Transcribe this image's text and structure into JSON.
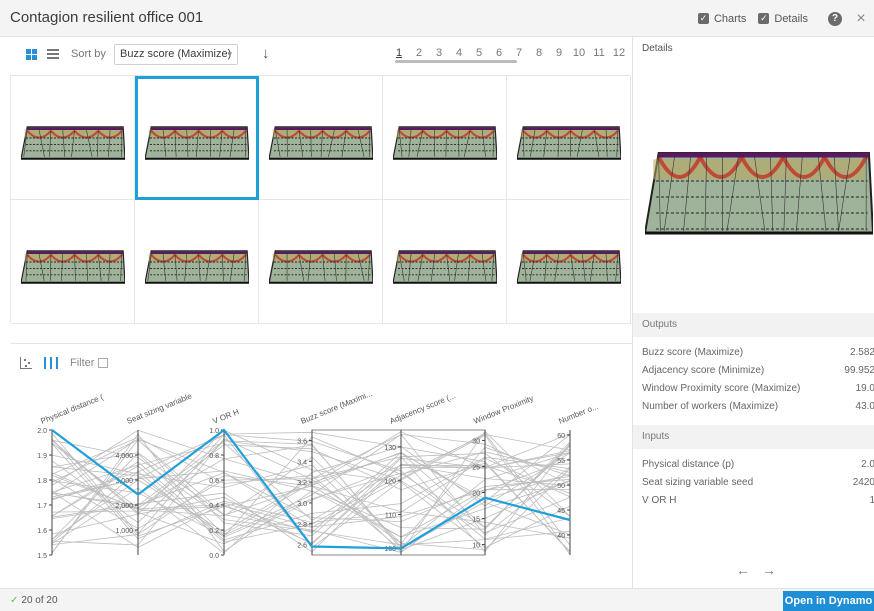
{
  "window": {
    "title": "Contagion resilient office 001",
    "charts_label": "Charts",
    "details_label": "Details",
    "help_symbol": "?",
    "close_symbol": "×"
  },
  "toolbar": {
    "sort_label": "Sort by",
    "sort_value": "Buzz score (Maximize)",
    "sort_direction_icon": "arrow-down-icon",
    "pages": [
      "1",
      "2",
      "3",
      "4",
      "5",
      "6",
      "7",
      "8",
      "9",
      "10",
      "11",
      "12"
    ],
    "active_page": "1"
  },
  "chart_toolbar": {
    "filter_label": "Filter"
  },
  "chart_data": {
    "type": "parallel-coordinates",
    "axes": [
      {
        "name": "Physical distance (",
        "ticks": [
          "2.0",
          "1.9",
          "1.8",
          "1.7",
          "1.6",
          "1.5"
        ],
        "range": [
          1.5,
          2.0
        ]
      },
      {
        "name": "Seat sizing variable",
        "ticks": [
          "4,000",
          "3,000",
          "2,000",
          "1,000"
        ],
        "range": [
          0,
          5000
        ]
      },
      {
        "name": "V OR H",
        "ticks": [
          "1.0",
          "0.8",
          "0.6",
          "0.4",
          "0.2",
          "0.0"
        ],
        "range": [
          0,
          1
        ]
      },
      {
        "name": "Buzz score (Maximi...",
        "ticks": [
          "3.6",
          "3.4",
          "3.2",
          "3.0",
          "2.8",
          "2.6"
        ],
        "range": [
          2.5,
          3.7
        ]
      },
      {
        "name": "Adjacency score (...",
        "ticks": [
          "130",
          "120",
          "110",
          "100"
        ],
        "range": [
          98,
          135
        ]
      },
      {
        "name": "Window Proximity",
        "ticks": [
          "30",
          "25",
          "20",
          "15",
          "10"
        ],
        "range": [
          8,
          32
        ]
      },
      {
        "name": "Number o...",
        "ticks": [
          "60",
          "55",
          "50",
          "45",
          "40"
        ],
        "range": [
          36,
          61
        ]
      }
    ],
    "highlight": [
      2.0,
      2420,
      1,
      2.582,
      99.952,
      19.0,
      43.0
    ]
  },
  "details": {
    "header": "Details",
    "outputs_header": "Outputs",
    "inputs_header": "Inputs",
    "outputs": [
      {
        "label": "Buzz score (Maximize)",
        "value": "2.582"
      },
      {
        "label": "Adjacency score (Minimize)",
        "value": "99.952"
      },
      {
        "label": "Window Proximity score (Maximize)",
        "value": "19.0"
      },
      {
        "label": "Number of workers (Maximize)",
        "value": "43.0"
      }
    ],
    "inputs": [
      {
        "label": "Physical distance (p)",
        "value": "2.0"
      },
      {
        "label": "Seat sizing variable seed",
        "value": "2420"
      },
      {
        "label": "V OR H",
        "value": "1"
      }
    ]
  },
  "status": {
    "count_text": "20 of 20",
    "open_button": "Open in Dynamo"
  }
}
